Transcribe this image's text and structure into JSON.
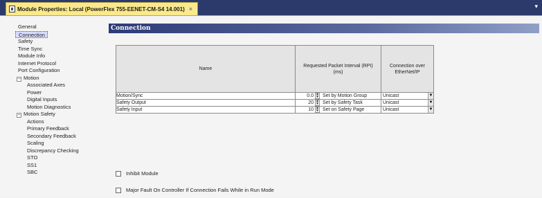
{
  "tab": {
    "title": "Module Properties: Local (PowerFlex 755-EENET-CM-S4 14.001)",
    "close": "×"
  },
  "tabbar": {
    "menu_arrow": "▾"
  },
  "tree": {
    "general": "General",
    "connection": "Connection",
    "safety": "Safety",
    "time_sync": "Time Sync",
    "module_info": "Module Info",
    "internet_protocol": "Internet Protocol",
    "port_configuration": "Port Configuration",
    "motion": "Motion",
    "associated_axes": "Associated Axes",
    "power": "Power",
    "digital_inputs": "Digital Inputs",
    "motion_diagnostics": "Motion Diagnostics",
    "motion_safety": "Motion Safety",
    "actions": "Actions",
    "primary_feedback": "Primary Feedback",
    "secondary_feedback": "Secondary Feedback",
    "scaling": "Scaling",
    "discrepancy_checking": "Discrepancy Checking",
    "sto": "STO",
    "ss1": "SS1",
    "sbc": "SBC",
    "toggle_minus": "−"
  },
  "content": {
    "title": "Connection",
    "table": {
      "col_name": "Name",
      "col_rpi": "Requested Packet Interval (RPI) (ms)",
      "col_conn": "Connection over EtherNet/IP",
      "rows": [
        {
          "name": "Motion/Sync",
          "rpi": "0.0",
          "rpi_desc": "Set by Motion Group",
          "conn": "Unicast"
        },
        {
          "name": "Safety Output",
          "rpi": "20",
          "rpi_desc": "Set by Safety Task",
          "conn": "Unicast"
        },
        {
          "name": "Safety Input",
          "rpi": "10",
          "rpi_desc": "Set on Safety Page",
          "conn": "Unicast"
        }
      ]
    },
    "inhibit_label": "Inhibit Module",
    "major_fault_label": "Major Fault On Controller If Connection Fails While in Run Mode"
  },
  "colors": {
    "tab_bg": "#fbe98c",
    "header_bar": "#2c3b77",
    "selection": "#d9dcff"
  }
}
